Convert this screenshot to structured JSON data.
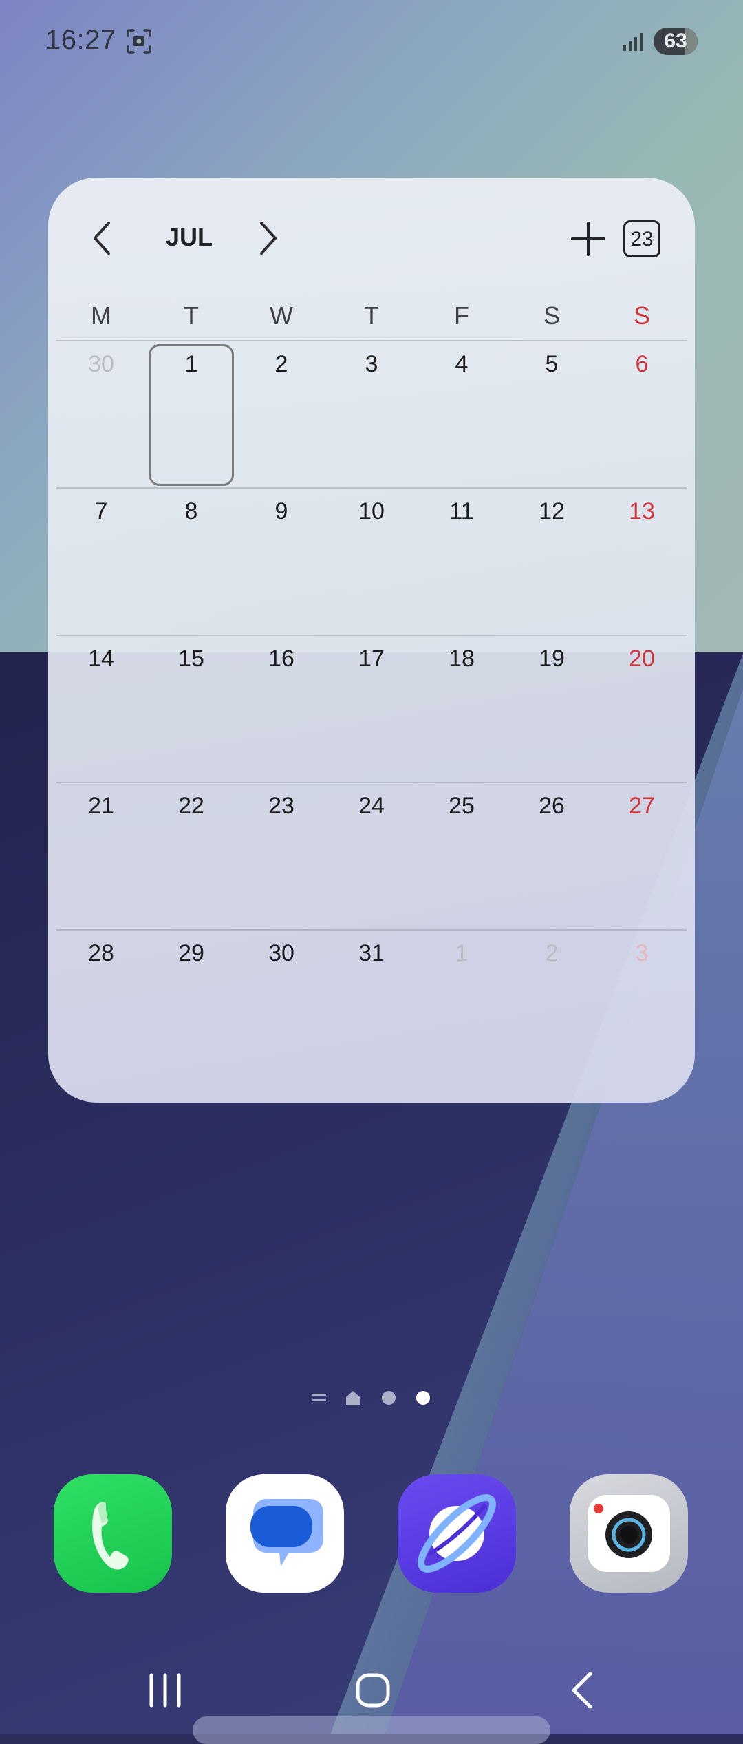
{
  "status_bar": {
    "time": "16:27",
    "battery": "63",
    "battery_level": 0.63
  },
  "calendar_widget": {
    "month": "JUL",
    "today_button_label": "23",
    "weekdays": [
      "M",
      "T",
      "W",
      "T",
      "F",
      "S",
      "S"
    ],
    "weeks": [
      [
        "30",
        "1",
        "2",
        "3",
        "4",
        "5",
        "6"
      ],
      [
        "7",
        "8",
        "9",
        "10",
        "11",
        "12",
        "13"
      ],
      [
        "14",
        "15",
        "16",
        "17",
        "18",
        "19",
        "20"
      ],
      [
        "21",
        "22",
        "23",
        "24",
        "25",
        "26",
        "27"
      ],
      [
        "28",
        "29",
        "30",
        "31",
        "1",
        "2",
        "3"
      ]
    ],
    "selected_day": "1",
    "accent_color": "#d1333c"
  },
  "home_pages": {
    "count": 2,
    "current": 2
  },
  "dock": {
    "apps": [
      "phone",
      "messages",
      "internet",
      "camera"
    ]
  },
  "icons": [
    "screenshot-icon",
    "signal-icon",
    "chevron-left-icon",
    "chevron-right-icon",
    "plus-icon",
    "recents-icon",
    "home-icon",
    "back-icon"
  ]
}
